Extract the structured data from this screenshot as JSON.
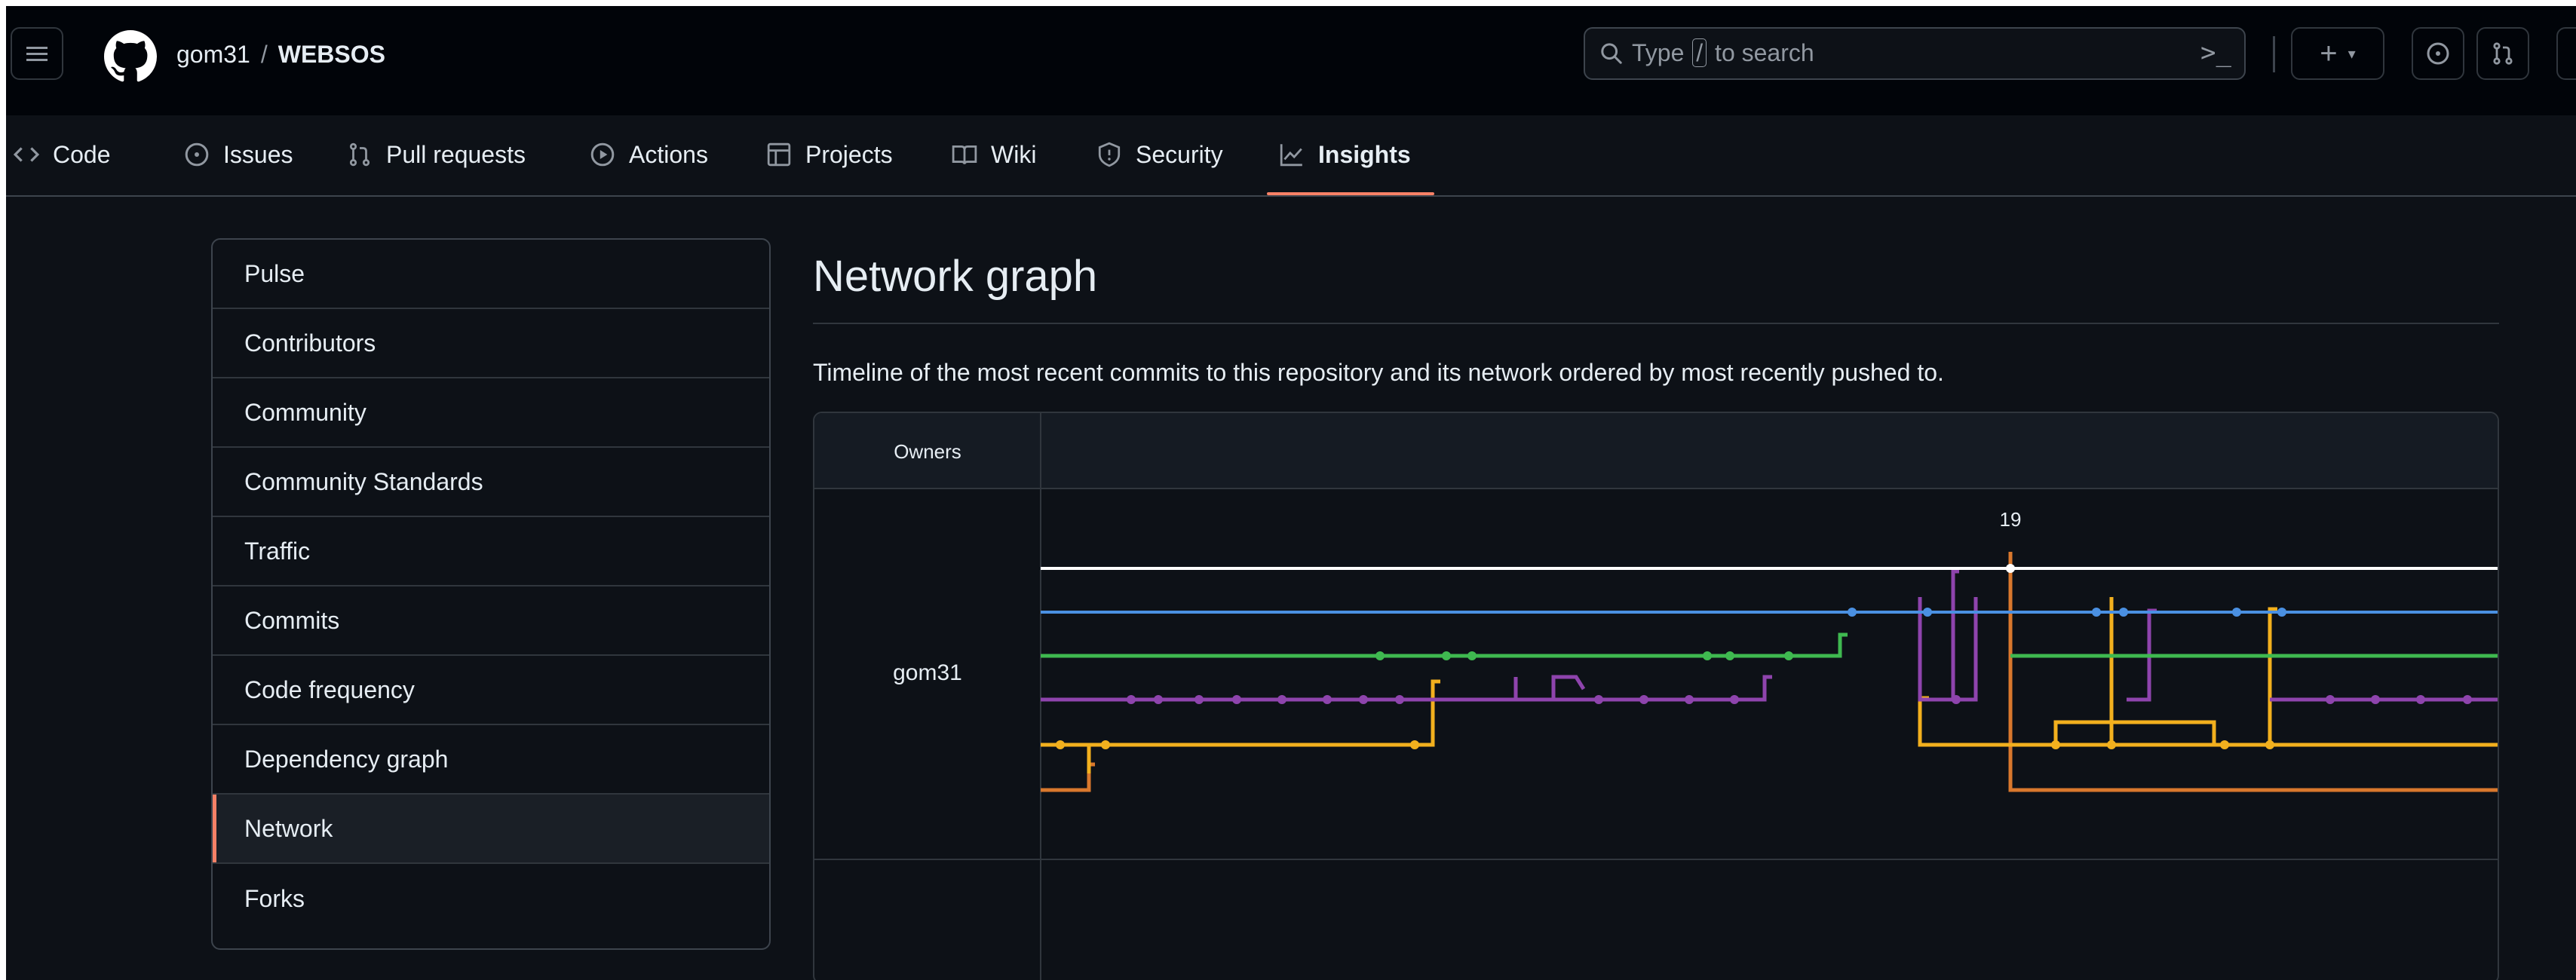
{
  "header": {
    "owner": "gom31",
    "separator": "/",
    "repo": "WEBSOS",
    "search": {
      "prefix": "Type",
      "key": "/",
      "suffix": "to search",
      "command_icon": ">_"
    },
    "create_label": "+"
  },
  "tabs": [
    {
      "label": "Code",
      "icon": "code-icon"
    },
    {
      "label": "Issues",
      "icon": "issue-opened-icon"
    },
    {
      "label": "Pull requests",
      "icon": "git-pull-request-icon"
    },
    {
      "label": "Actions",
      "icon": "play-icon"
    },
    {
      "label": "Projects",
      "icon": "table-icon"
    },
    {
      "label": "Wiki",
      "icon": "book-icon"
    },
    {
      "label": "Security",
      "icon": "shield-icon"
    },
    {
      "label": "Insights",
      "icon": "graph-icon",
      "selected": true
    }
  ],
  "sidebar": {
    "items": [
      {
        "label": "Pulse"
      },
      {
        "label": "Contributors"
      },
      {
        "label": "Community"
      },
      {
        "label": "Community Standards"
      },
      {
        "label": "Traffic"
      },
      {
        "label": "Commits"
      },
      {
        "label": "Code frequency"
      },
      {
        "label": "Dependency graph"
      },
      {
        "label": "Network",
        "selected": true
      },
      {
        "label": "Forks"
      }
    ]
  },
  "main": {
    "title": "Network graph",
    "description": "Timeline of the most recent commits to this repository and its network ordered by most recently pushed to.",
    "graph": {
      "owners_header": "Owners",
      "owner": "gom31",
      "date_label": "19",
      "colors": {
        "white": "#ffffff",
        "blue": "#4a90e2",
        "green": "#3fb950",
        "purple": "#8e44ad",
        "yellow": "#f2b01e",
        "orange": "#d9782d"
      }
    }
  },
  "colors": {
    "page_background": "#0d1117",
    "header_background": "#010409",
    "accent": "#f78166",
    "border": "#30363d",
    "muted_text": "#9198a1"
  }
}
